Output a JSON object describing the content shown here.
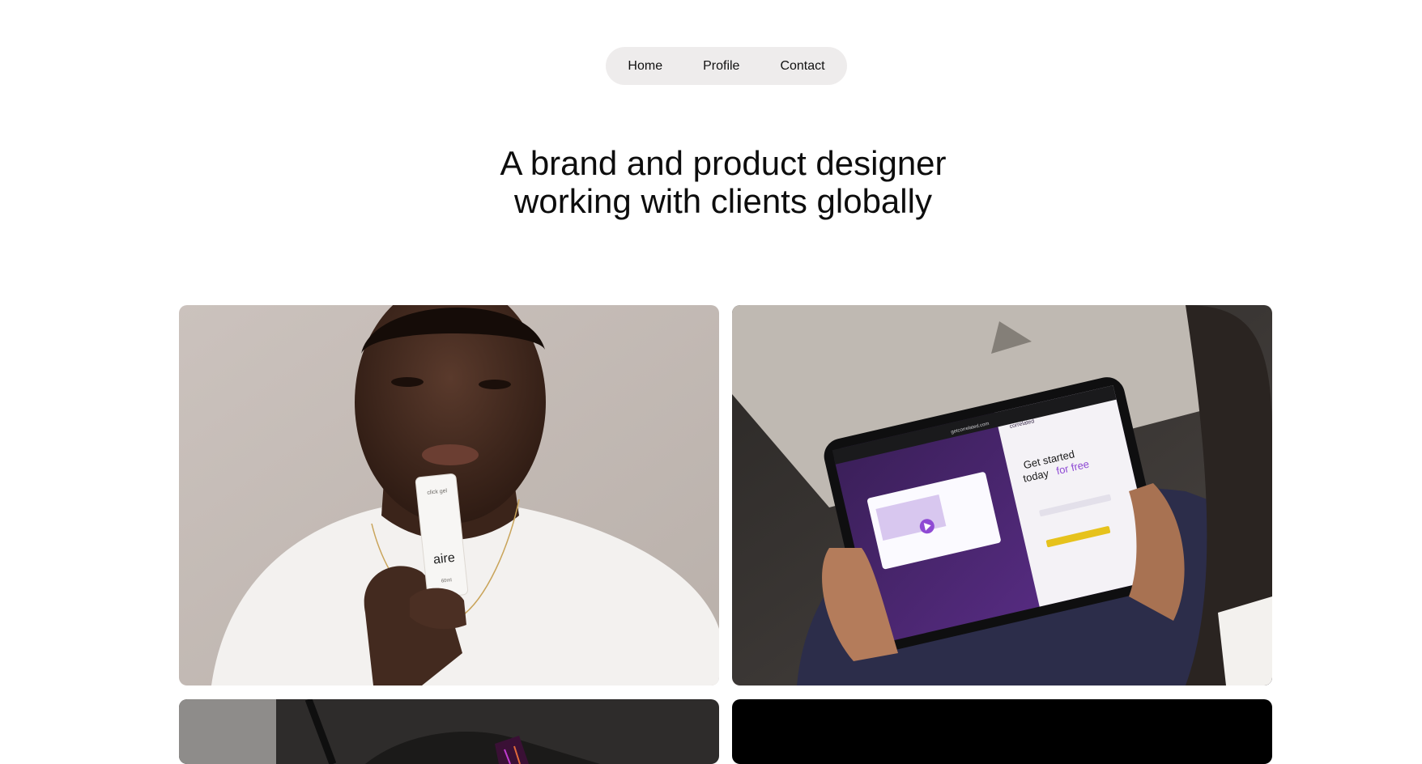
{
  "nav": {
    "items": [
      {
        "label": "Home"
      },
      {
        "label": "Profile"
      },
      {
        "label": "Contact"
      }
    ]
  },
  "hero": {
    "line1": "A brand and product designer",
    "line2": "working with clients globally"
  },
  "projects": [
    {
      "brand_mark": "aire",
      "product_label_top": "click gel",
      "product_label_bottom": "60ml"
    },
    {
      "tablet": {
        "url": "getcorrelated.com",
        "logo": "correlated",
        "headline_1": "Get started",
        "headline_2a": "today",
        "headline_2b": "for free",
        "accent": "#8f4ad4"
      }
    },
    {},
    {}
  ]
}
